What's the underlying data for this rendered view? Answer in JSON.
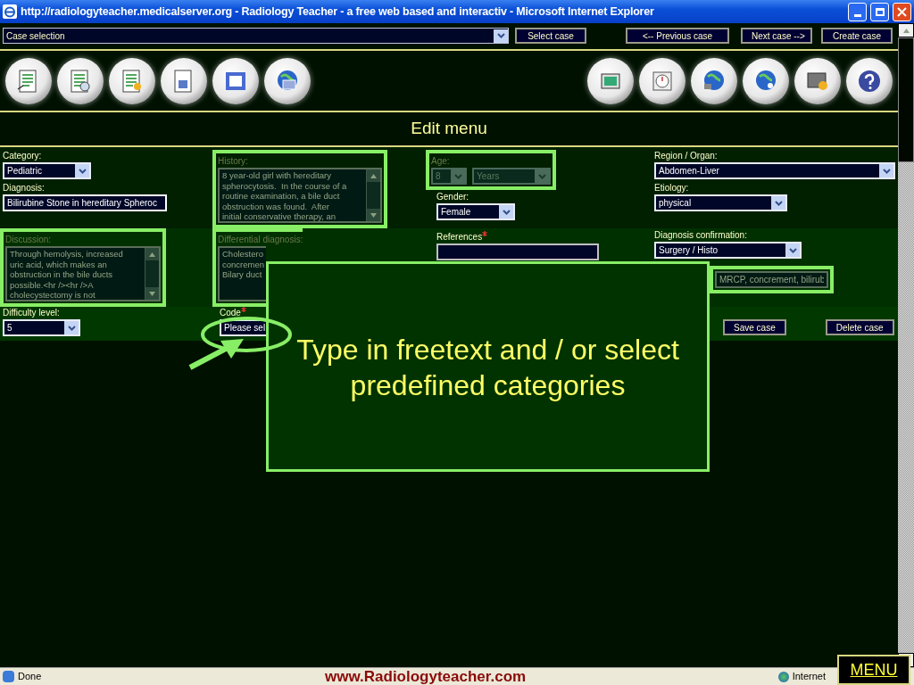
{
  "window": {
    "title": "http://radiologyteacher.medicalserver.org - Radiology Teacher - a free web based and interactiv - Microsoft Internet Explorer"
  },
  "toolbar": {
    "case_selection": "Case selection",
    "buttons": [
      "Select case",
      "<-- Previous case",
      "Next case -->",
      "Create case"
    ]
  },
  "header": "Edit menu",
  "fields": {
    "category": {
      "label": "Category:",
      "kind": "select",
      "value": "Pediatric",
      "highlighted": false,
      "disabled": false,
      "required": false
    },
    "diagnosis": {
      "label": "Diagnosis:",
      "kind": "text",
      "value": "Bilirubine Stone in hereditary Spheroc",
      "highlighted": false,
      "disabled": false,
      "required": false
    },
    "history": {
      "label": "History:",
      "kind": "textarea",
      "lines": [
        "8 year-old girl with hereditary",
        "spherocytosis.  In the course of a",
        "routine examination, a bile duct",
        "obstruction was found.  After",
        "initial conservative therapy, an"
      ],
      "highlighted": true,
      "disabled": true,
      "required": false
    },
    "age": {
      "label": "Age:",
      "kind": "select_pair",
      "value": "8",
      "unit": "Years",
      "highlighted": true,
      "disabled": true,
      "required": false
    },
    "gender": {
      "label": "Gender:",
      "kind": "select",
      "value": "Female",
      "highlighted": false,
      "disabled": false,
      "required": false
    },
    "region": {
      "label": "Region / Organ:",
      "kind": "select",
      "value": "Abdomen-Liver",
      "highlighted": false,
      "disabled": false,
      "required": false
    },
    "etiology": {
      "label": "Etiology:",
      "kind": "select",
      "value": "physical",
      "highlighted": false,
      "disabled": false,
      "required": false
    },
    "discussion": {
      "label": "Discussion:",
      "kind": "textarea",
      "lines": [
        "Through hemolysis, increased",
        "uric acid, which makes an",
        "obstruction in the bile ducts",
        "possible.<hr /><hr />A",
        "cholecystectomy is not"
      ],
      "highlighted": true,
      "disabled": true,
      "required": false
    },
    "differential": {
      "label": "Differential diagnosis:",
      "kind": "textarea_covered",
      "lines": [
        "Cholestero",
        "concremen",
        "Bilary duct"
      ],
      "highlighted": true,
      "disabled": true
    },
    "references": {
      "label": "References",
      "kind": "covered",
      "highlighted": false,
      "disabled": false,
      "required": true
    },
    "confirmation": {
      "label": "Diagnosis confirmation:",
      "kind": "select",
      "value": "Surgery / Histo",
      "highlighted": false,
      "disabled": false,
      "required": false
    },
    "keywords": {
      "kind": "text",
      "value": "MRCP, concrement, bilirub",
      "highlighted": true,
      "disabled": true
    },
    "difficulty": {
      "label": "Difficulty level:",
      "kind": "select",
      "value": "5",
      "highlighted": false,
      "disabled": false,
      "required": false
    },
    "code": {
      "label": "Code",
      "kind": "select_covered",
      "value": "Please sel",
      "highlighted": false,
      "disabled": false,
      "required": true
    }
  },
  "actions": [
    "Save case",
    "Delete case"
  ],
  "callout": {
    "text": "Type in freetext and / or select predefined categories"
  },
  "status_bar": {
    "status": "Done",
    "site": "www.Radiologyteacher.com",
    "zone": "Internet"
  },
  "menu_button": "MENU"
}
